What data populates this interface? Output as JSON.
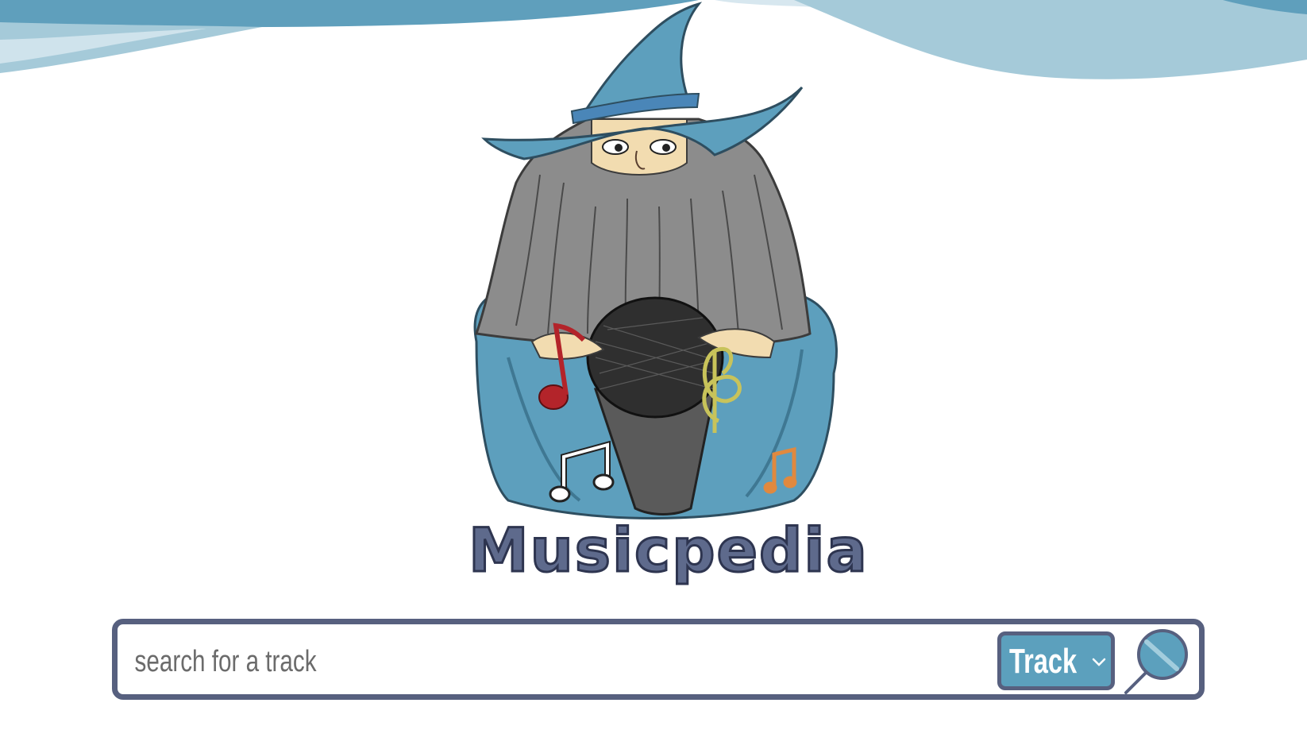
{
  "brand": {
    "logo_text": "Musicpedia",
    "mascot": "wizard-with-microphone"
  },
  "search": {
    "placeholder": "search for a track",
    "value": "",
    "type_selected": "Track",
    "type_options": [
      "Track"
    ],
    "submit_icon": "magnifier-icon"
  },
  "colors": {
    "accent": "#5ca0bd",
    "border": "#57607f",
    "logo_text": "#5e6a8c",
    "wave_light": "#cfe3ec",
    "wave_dark": "#6aa7c2"
  }
}
